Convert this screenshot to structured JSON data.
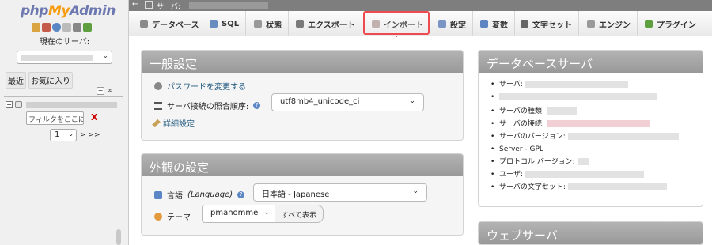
{
  "sidebar": {
    "logo": {
      "php": "php",
      "my": "My",
      "admin": "Admin"
    },
    "current_server_label": "現在のサーバ:",
    "tabs": [
      "最近",
      "お気に入り"
    ],
    "collapse_symbol": "−",
    "link_symbol": "∞",
    "filter_placeholder": "フィルタをここに...",
    "filter_clear": "X",
    "page_select": "1",
    "next_pages": "> >>"
  },
  "topbar": {
    "server_label": "サーバ:"
  },
  "tabs": [
    {
      "label": "データベース",
      "icon": "database-icon",
      "color": "#8a8a8a"
    },
    {
      "label": "SQL",
      "icon": "sql-icon",
      "color": "#6a8dbf"
    },
    {
      "label": "状態",
      "icon": "status-icon",
      "color": "#999999"
    },
    {
      "label": "エクスポート",
      "icon": "export-icon",
      "color": "#7a7a7a"
    },
    {
      "label": "インポート",
      "icon": "import-icon",
      "color": "#b5a3a3"
    },
    {
      "label": "設定",
      "icon": "settings-icon",
      "color": "#7a94c4"
    },
    {
      "label": "変数",
      "icon": "variables-icon",
      "color": "#5e85c2"
    },
    {
      "label": "文字セット",
      "icon": "charset-icon",
      "color": "#666666"
    },
    {
      "label": "エンジン",
      "icon": "engine-icon",
      "color": "#9a9a9a"
    },
    {
      "label": "プラグイン",
      "icon": "plugin-icon",
      "color": "#5f9f3f"
    }
  ],
  "general": {
    "title": "一般設定",
    "change_password": "パスワードを変更する",
    "collation_label": "サーバ接続の照合順序:",
    "collation_value": "utf8mb4_unicode_ci",
    "more_settings": "詳細設定"
  },
  "appearance": {
    "title": "外観の設定",
    "language_label": "言語",
    "language_label_en": "(Language)",
    "language_value": "日本語 - Japanese",
    "theme_label": "テーマ",
    "theme_value": "pmahomme",
    "show_all": "すべて表示"
  },
  "dbserver": {
    "title": "データベースサーバ",
    "items": [
      "サーバ:",
      "サーバの種類:",
      "サーバの接続:",
      "サーバのバージョン:",
      "Server - GPL",
      "プロトコル バージョン:",
      "ユーザ:",
      "サーバの文字セット:"
    ]
  },
  "webserver": {
    "title": "ウェブサーバ"
  },
  "colors": {
    "highlight": "#ee4b50",
    "link": "#235a81",
    "panel_header": "#a6a6a6"
  }
}
